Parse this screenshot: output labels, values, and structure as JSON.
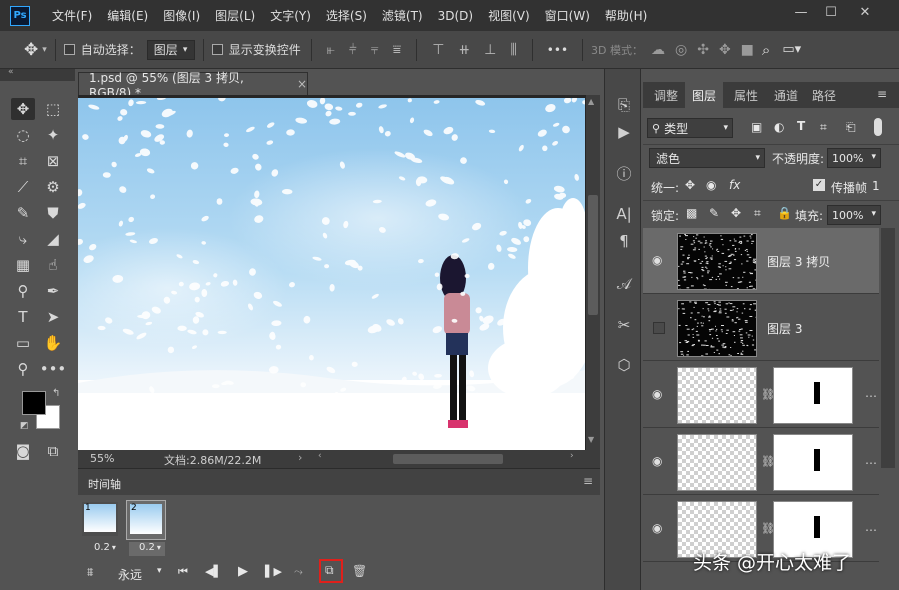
{
  "app": {
    "logo": "Ps"
  },
  "menu": [
    "文件(F)",
    "编辑(E)",
    "图像(I)",
    "图层(L)",
    "文字(Y)",
    "选择(S)",
    "滤镜(T)",
    "3D(D)",
    "视图(V)",
    "窗口(W)",
    "帮助(H)"
  ],
  "window_controls": {
    "minimize": "—",
    "maximize": "☐",
    "close": "✕"
  },
  "options": {
    "auto_select_label": "自动选择：",
    "auto_select_value": "图层",
    "transform_label": "显示变换控件",
    "more": "•••",
    "mode_3d": "3D 模式："
  },
  "document": {
    "tab_title": "1.psd @ 55% (图层 3 拷贝, RGB/8) *",
    "close": "×",
    "zoom": "55%",
    "doc_info": "文档:2.86M/22.2M"
  },
  "timeline": {
    "title": "时间轴",
    "frames": [
      {
        "number": "1",
        "delay": "0.2",
        "selected": false
      },
      {
        "number": "2",
        "delay": "0.2",
        "selected": true
      }
    ],
    "loop": "永远"
  },
  "panel_tabs": [
    {
      "label": "调整",
      "active": false
    },
    {
      "label": "图层",
      "active": true
    },
    {
      "label": "属性",
      "active": false
    },
    {
      "label": "通道",
      "active": false
    },
    {
      "label": "路径",
      "active": false
    }
  ],
  "layers_panel": {
    "filter_kind": "类型",
    "blend_mode": "滤色",
    "opacity_label": "不透明度:",
    "opacity_value": "100%",
    "unify_label": "统一:",
    "propagate_label": "传播帧",
    "propagate_value": "1",
    "lock_label": "锁定:",
    "fill_label": "填充:",
    "fill_value": "100%",
    "layers": [
      {
        "name": "图层 3 拷贝",
        "visible": true,
        "selected": true,
        "type": "noise"
      },
      {
        "name": "图层 3",
        "visible": false,
        "selected": false,
        "type": "noise"
      },
      {
        "name": "",
        "visible": true,
        "selected": false,
        "type": "masked"
      },
      {
        "name": "",
        "visible": true,
        "selected": false,
        "type": "masked"
      },
      {
        "name": "",
        "visible": true,
        "selected": false,
        "type": "masked"
      }
    ]
  },
  "watermark": "头条 @开心太难了",
  "colors": {
    "menubar": "#323232",
    "panel": "#535353",
    "highlight_red": "#e0201b",
    "sky_blue": "#a9d3f0"
  }
}
